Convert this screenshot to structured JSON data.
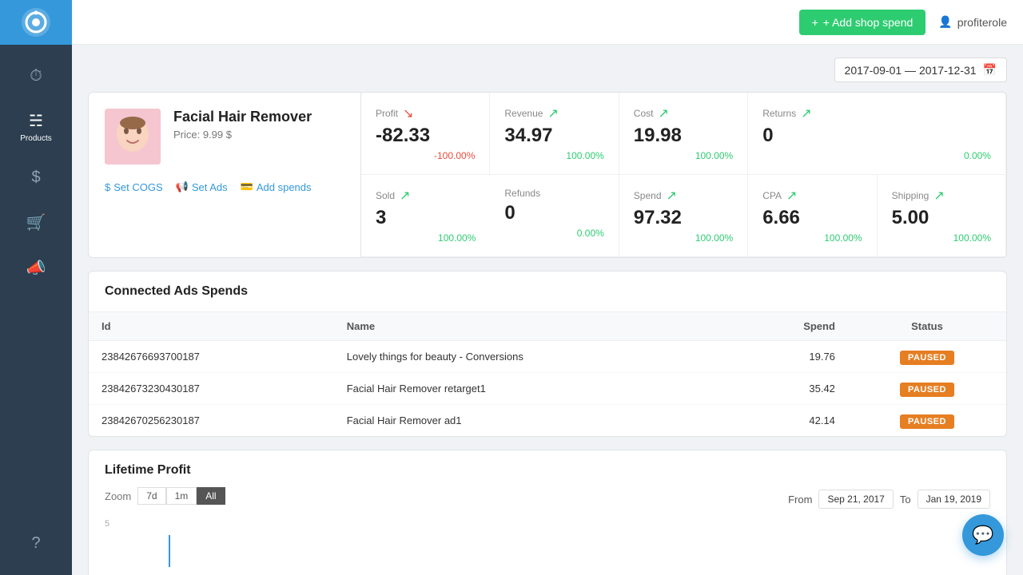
{
  "sidebar": {
    "logo_alt": "App Logo",
    "items": [
      {
        "id": "dashboard",
        "label": "",
        "icon": "🕐",
        "active": false
      },
      {
        "id": "products",
        "label": "Products",
        "icon": "📦",
        "active": true
      },
      {
        "id": "finance",
        "label": "",
        "icon": "$",
        "active": false
      },
      {
        "id": "cart",
        "label": "",
        "icon": "🛒",
        "active": false
      },
      {
        "id": "marketing",
        "label": "",
        "icon": "📣",
        "active": false
      }
    ],
    "help_icon": "?"
  },
  "topbar": {
    "add_shop_label": "+ Add shop spend",
    "user_icon": "👤",
    "username": "profiterole"
  },
  "date_range": {
    "value": "2017-09-01 — 2017-12-31",
    "calendar_icon": "📅"
  },
  "product": {
    "name": "Facial Hair Remover",
    "price_label": "Price: 9.99 $",
    "image_alt": "Facial Hair Remover product",
    "actions": [
      {
        "id": "set-cogs",
        "icon": "$",
        "label": "Set COGS"
      },
      {
        "id": "set-ads",
        "icon": "📢",
        "label": "Set Ads"
      },
      {
        "id": "add-spends",
        "icon": "💳",
        "label": "Add spends"
      }
    ]
  },
  "metrics_row1": [
    {
      "id": "profit",
      "label": "Profit",
      "trend": "down",
      "value": "-82.33",
      "pct": "-100.00%",
      "pct_color": "red"
    },
    {
      "id": "revenue",
      "label": "Revenue",
      "trend": "up",
      "value": "34.97",
      "pct": "100.00%",
      "pct_color": "green"
    },
    {
      "id": "cost",
      "label": "Cost",
      "trend": "up",
      "value": "19.98",
      "pct": "100.00%",
      "pct_color": "green"
    },
    {
      "id": "returns",
      "label": "Returns",
      "trend": "up",
      "value": "0",
      "pct": "0.00%",
      "pct_color": "green"
    }
  ],
  "metrics_row2": [
    {
      "id": "sold",
      "label": "Sold",
      "trend": "up",
      "value": "3",
      "pct": "100.00%",
      "pct_color": "green"
    },
    {
      "id": "refunds",
      "label": "Refunds",
      "trend": "none",
      "value": "0",
      "pct": "0.00%",
      "pct_color": "green"
    },
    {
      "id": "spend",
      "label": "Spend",
      "trend": "up",
      "value": "97.32",
      "pct": "100.00%",
      "pct_color": "green"
    },
    {
      "id": "cpa",
      "label": "CPA",
      "trend": "up",
      "value": "6.66",
      "pct": "100.00%",
      "pct_color": "green"
    },
    {
      "id": "shipping",
      "label": "Shipping",
      "trend": "up",
      "value": "5.00",
      "pct": "100.00%",
      "pct_color": "green"
    }
  ],
  "connected_ads": {
    "title": "Connected Ads Spends",
    "headers": [
      "Id",
      "Name",
      "Spend",
      "Status"
    ],
    "rows": [
      {
        "id": "23842676693700187",
        "name": "Lovely things for beauty - Conversions",
        "spend": "19.76",
        "status": "PAUSED"
      },
      {
        "id": "23842673230430187",
        "name": "Facial Hair Remover retarget1",
        "spend": "35.42",
        "status": "PAUSED"
      },
      {
        "id": "23842670256230187",
        "name": "Facial Hair Remover ad1",
        "spend": "42.14",
        "status": "PAUSED"
      }
    ]
  },
  "lifetime_profit": {
    "title": "Lifetime Profit",
    "zoom_label": "Zoom",
    "zoom_options": [
      "7d",
      "1m",
      "All"
    ],
    "active_zoom": "All",
    "from_label": "From",
    "to_label": "To",
    "from_date": "Sep 21, 2017",
    "to_date": "Jan 19, 2019",
    "chart_y_value": "5"
  }
}
